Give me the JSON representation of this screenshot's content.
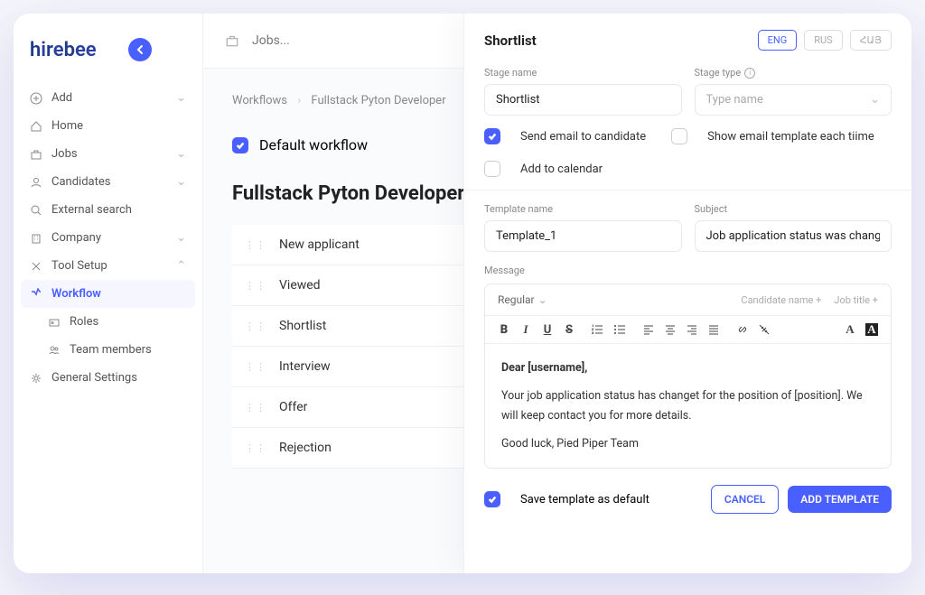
{
  "brand": {
    "name": "hirebee"
  },
  "search": {
    "placeholder": "Jobs..."
  },
  "sidebar": {
    "add": "Add",
    "home": "Home",
    "jobs": "Jobs",
    "candidates": "Candidates",
    "external": "External search",
    "company": "Company",
    "toolSetup": "Tool Setup",
    "workflow": "Workflow",
    "roles": "Roles",
    "team": "Team members",
    "general": "General Settings"
  },
  "breadcrumb": {
    "root": "Workflows",
    "current": "Fullstack Pyton Developer"
  },
  "workflow": {
    "defaultLabel": "Default workflow",
    "title": "Fullstack Pyton Developer",
    "stages": [
      "New applicant",
      "Viewed",
      "Shortlist",
      "Interview",
      "Offer",
      "Rejection"
    ]
  },
  "panel": {
    "title": "Shortlist",
    "lang": {
      "eng": "ENG",
      "rus": "RUS",
      "arm": "ՀԱՅ"
    },
    "stageNameLabel": "Stage name",
    "stageNameValue": "Shortlist",
    "stageTypeLabel": "Stage type",
    "stageTypePlaceholder": "Type name",
    "sendEmail": "Send email to candidate",
    "showTemplate": "Show email template each tiime",
    "addCalendar": "Add to calendar",
    "templateNameLabel": "Template name",
    "templateNameValue": "Template_1",
    "subjectLabel": "Subject",
    "subjectValue": "Job application status was changed",
    "messageLabel": "Message",
    "regular": "Regular",
    "insertCandidate": "Candidate name",
    "insertJob": "Job title",
    "emailGreeting": "Dear [username],",
    "emailBody": "Your job application status has changet for the position of [position]. We will keep contact you for more details.",
    "emailSign": "Good luck, Pied Piper Team",
    "saveDefault": "Save template as default",
    "cancel": "CANCEL",
    "addTemplate": "ADD TEMPLATE"
  }
}
